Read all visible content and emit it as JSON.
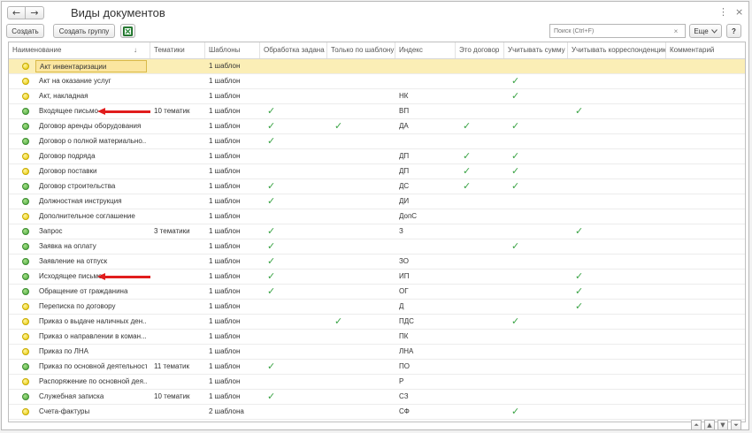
{
  "titlebar": {
    "title": "Виды документов",
    "back_icon": "←",
    "forward_icon": "→",
    "more_icon": "⋮",
    "close_icon": "×"
  },
  "toolbar": {
    "create_label": "Создать",
    "create_group_label": "Создать группу",
    "search_placeholder": "Поиск (Ctrl+F)",
    "clear_icon": "×",
    "more_label": "Еще",
    "help_label": "?"
  },
  "columns": [
    "Наименование",
    "Тематики",
    "Шаблоны",
    "Обработка задана",
    "Только по шаблону",
    "Индекс",
    "Это договор",
    "Учитывать сумму",
    "Учитывать корреспонденцию",
    "Комментарий"
  ],
  "sort_indicator": "↓",
  "rows": [
    {
      "status": "yellow",
      "name": "Акт инвентаризации",
      "topics": "",
      "templates": "1 шаблон",
      "processing": false,
      "template_only": false,
      "index": "",
      "contract": false,
      "sum": false,
      "corr": false,
      "comment": "",
      "selected": true
    },
    {
      "status": "yellow",
      "name": "Акт на оказание услуг",
      "topics": "",
      "templates": "1 шаблон",
      "processing": false,
      "template_only": false,
      "index": "",
      "contract": false,
      "sum": true,
      "corr": false,
      "comment": ""
    },
    {
      "status": "yellow",
      "name": "Акт, накладная",
      "topics": "",
      "templates": "1 шаблон",
      "processing": false,
      "template_only": false,
      "index": "НК",
      "contract": false,
      "sum": true,
      "corr": false,
      "comment": ""
    },
    {
      "status": "green",
      "name": "Входящее письмо",
      "topics": "10 тематик",
      "templates": "1 шаблон",
      "processing": true,
      "template_only": false,
      "index": "ВП",
      "contract": false,
      "sum": false,
      "corr": true,
      "comment": "",
      "arrow": true
    },
    {
      "status": "green",
      "name": "Договор аренды оборудования",
      "topics": "",
      "templates": "1 шаблон",
      "processing": true,
      "template_only": true,
      "index": "ДА",
      "contract": true,
      "sum": true,
      "corr": false,
      "comment": ""
    },
    {
      "status": "green",
      "name": "Договор о полной материально...",
      "topics": "",
      "templates": "1 шаблон",
      "processing": true,
      "template_only": false,
      "index": "",
      "contract": false,
      "sum": false,
      "corr": false,
      "comment": ""
    },
    {
      "status": "yellow",
      "name": "Договор подряда",
      "topics": "",
      "templates": "1 шаблон",
      "processing": false,
      "template_only": false,
      "index": "ДП",
      "contract": true,
      "sum": true,
      "corr": false,
      "comment": ""
    },
    {
      "status": "yellow",
      "name": "Договор поставки",
      "topics": "",
      "templates": "1 шаблон",
      "processing": false,
      "template_only": false,
      "index": "ДП",
      "contract": true,
      "sum": true,
      "corr": false,
      "comment": ""
    },
    {
      "status": "green",
      "name": "Договор строительства",
      "topics": "",
      "templates": "1 шаблон",
      "processing": true,
      "template_only": false,
      "index": "ДС",
      "contract": true,
      "sum": true,
      "corr": false,
      "comment": ""
    },
    {
      "status": "green",
      "name": "Должностная инструкция",
      "topics": "",
      "templates": "1 шаблон",
      "processing": true,
      "template_only": false,
      "index": "ДИ",
      "contract": false,
      "sum": false,
      "corr": false,
      "comment": ""
    },
    {
      "status": "yellow",
      "name": "Дополнительное соглашение",
      "topics": "",
      "templates": "1 шаблон",
      "processing": false,
      "template_only": false,
      "index": "ДопС",
      "contract": false,
      "sum": false,
      "corr": false,
      "comment": ""
    },
    {
      "status": "green",
      "name": "Запрос",
      "topics": "3 тематики",
      "templates": "1 шаблон",
      "processing": true,
      "template_only": false,
      "index": "З",
      "contract": false,
      "sum": false,
      "corr": true,
      "comment": ""
    },
    {
      "status": "green",
      "name": "Заявка на оплату",
      "topics": "",
      "templates": "1 шаблон",
      "processing": true,
      "template_only": false,
      "index": "",
      "contract": false,
      "sum": true,
      "corr": false,
      "comment": ""
    },
    {
      "status": "green",
      "name": "Заявление на отпуск",
      "topics": "",
      "templates": "1 шаблон",
      "processing": true,
      "template_only": false,
      "index": "ЗО",
      "contract": false,
      "sum": false,
      "corr": false,
      "comment": ""
    },
    {
      "status": "green",
      "name": "Исходящее письмо",
      "topics": "",
      "templates": "1 шаблон",
      "processing": true,
      "template_only": false,
      "index": "ИП",
      "contract": false,
      "sum": false,
      "corr": true,
      "comment": "",
      "arrow": true
    },
    {
      "status": "green",
      "name": "Обращение от гражданина",
      "topics": "",
      "templates": "1 шаблон",
      "processing": true,
      "template_only": false,
      "index": "ОГ",
      "contract": false,
      "sum": false,
      "corr": true,
      "comment": ""
    },
    {
      "status": "yellow",
      "name": "Переписка по договору",
      "topics": "",
      "templates": "1 шаблон",
      "processing": false,
      "template_only": false,
      "index": "Д",
      "contract": false,
      "sum": false,
      "corr": true,
      "comment": ""
    },
    {
      "status": "yellow",
      "name": "Приказ о выдаче наличных ден...",
      "topics": "",
      "templates": "1 шаблон",
      "processing": false,
      "template_only": true,
      "index": "ПДС",
      "contract": false,
      "sum": true,
      "corr": false,
      "comment": ""
    },
    {
      "status": "yellow",
      "name": "Приказ о направлении в коман...",
      "topics": "",
      "templates": "1 шаблон",
      "processing": false,
      "template_only": false,
      "index": "ПК",
      "contract": false,
      "sum": false,
      "corr": false,
      "comment": ""
    },
    {
      "status": "yellow",
      "name": "Приказ по ЛНА",
      "topics": "",
      "templates": "1 шаблон",
      "processing": false,
      "template_only": false,
      "index": "ЛНА",
      "contract": false,
      "sum": false,
      "corr": false,
      "comment": ""
    },
    {
      "status": "green",
      "name": "Приказ по основной деятельности",
      "topics": "11 тематик",
      "templates": "1 шаблон",
      "processing": true,
      "template_only": false,
      "index": "ПО",
      "contract": false,
      "sum": false,
      "corr": false,
      "comment": ""
    },
    {
      "status": "yellow",
      "name": "Распоряжение по основной дея...",
      "topics": "",
      "templates": "1 шаблон",
      "processing": false,
      "template_only": false,
      "index": "Р",
      "contract": false,
      "sum": false,
      "corr": false,
      "comment": ""
    },
    {
      "status": "green",
      "name": "Служебная записка",
      "topics": "10 тематик",
      "templates": "1 шаблон",
      "processing": true,
      "template_only": false,
      "index": "СЗ",
      "contract": false,
      "sum": false,
      "corr": false,
      "comment": ""
    },
    {
      "status": "yellow",
      "name": "Счета-фактуры",
      "topics": "",
      "templates": "2 шаблона",
      "processing": false,
      "template_only": false,
      "index": "СФ",
      "contract": false,
      "sum": true,
      "corr": false,
      "comment": ""
    }
  ],
  "check_glyph": "✓",
  "colors": {
    "check": "#3aa345",
    "selected_row": "#fbeeb6",
    "arrow": "#e11d1d",
    "status_green": "#48a63a",
    "status_yellow": "#e7c900"
  },
  "pager": {
    "first": "⏶",
    "prev": "▲",
    "next": "▼",
    "last": "⏷"
  }
}
